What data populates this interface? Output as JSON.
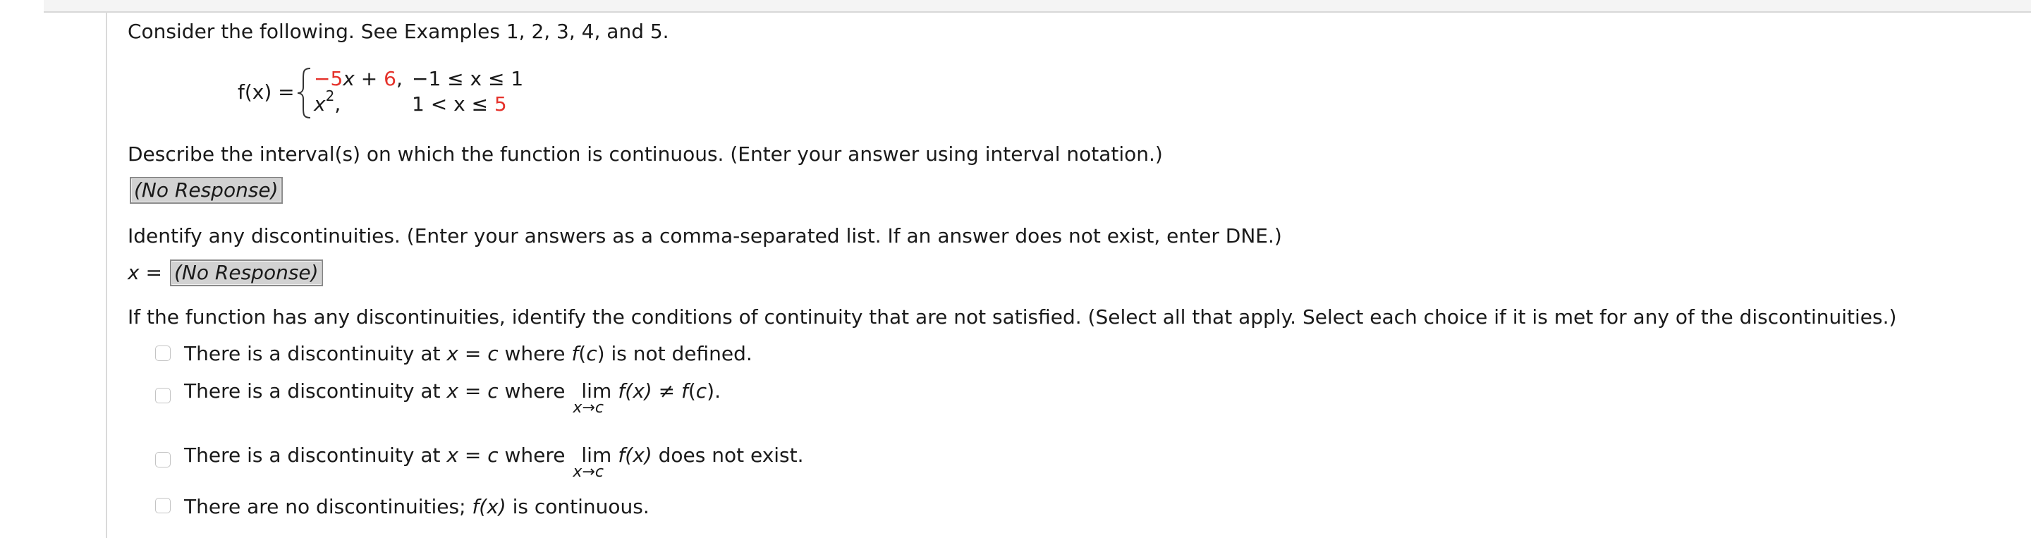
{
  "intro": "Consider the following. See Examples 1, 2, 3, 4, and 5.",
  "function": {
    "label": "f(x) =",
    "piece1": {
      "expr_coef": "−5",
      "expr_var": "x",
      "expr_op": " + ",
      "expr_const": "6",
      "expr_end": ",",
      "cond": "−1 ≤ x ≤ 1"
    },
    "piece2": {
      "expr_var": "x",
      "expr_exp": "2",
      "expr_end": ",",
      "cond_prefix": "1 < x ≤ ",
      "cond_value": "5"
    }
  },
  "q1": {
    "text": "Describe the interval(s) on which the function is continuous. (Enter your answer using interval notation.)",
    "response": "(No Response)"
  },
  "q2": {
    "text": "Identify any discontinuities. (Enter your answers as a comma-separated list. If an answer does not exist, enter DNE.)",
    "prefix": "x =",
    "response": "(No Response)"
  },
  "q3": {
    "text": "If the function has any discontinuities, identify the conditions of continuity that are not satisfied. (Select all that apply. Select each choice if it is met for any of the discontinuities.)",
    "options": [
      {
        "pre": "There is a discontinuity at ",
        "var": "x",
        "eq": " = ",
        "c": "c",
        "mid": " where ",
        "fn": "f",
        "fnarg": "(c)",
        "post": " is not defined."
      },
      {
        "pre": "There is a discontinuity at ",
        "var": "x",
        "eq": " = ",
        "c": "c",
        "mid": " where ",
        "lim": "lim",
        "sub": "x→c",
        "fnx": "f(x)",
        "rel": " ≠ ",
        "fn": "f",
        "fnarg": "(c)",
        "post": "."
      },
      {
        "pre": "There is a discontinuity at ",
        "var": "x",
        "eq": " = ",
        "c": "c",
        "mid": " where ",
        "lim": "lim",
        "sub": "x→c",
        "fnx": "f(x)",
        "post": " does not exist."
      },
      {
        "pre": "There are no discontinuities; ",
        "fnx": "f(x)",
        "post": " is continuous."
      }
    ]
  }
}
